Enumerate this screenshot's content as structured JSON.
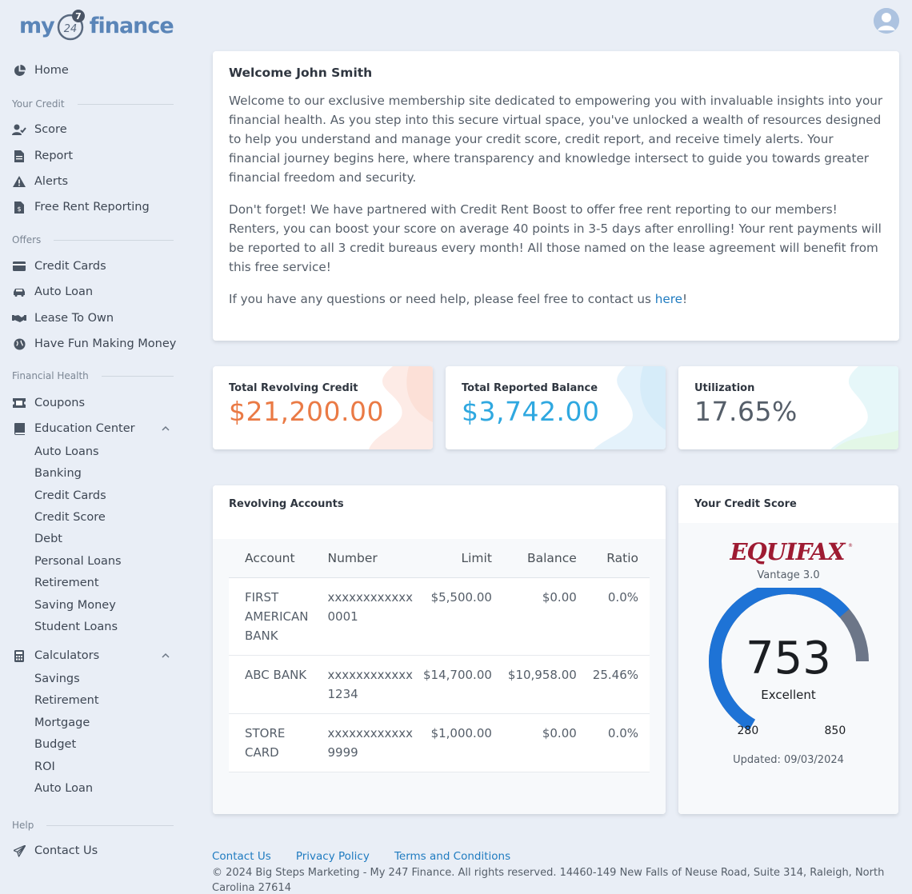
{
  "brand": {
    "logo_left": "my",
    "logo_clock": "247",
    "logo_right": "finance"
  },
  "colors": {
    "accent": "#1f7bc0",
    "orange": "#ea7a45",
    "blue": "#2fa8e0",
    "dark": "#555e69",
    "gauge_blue": "#1e73d6",
    "gauge_gray": "#6c7688"
  },
  "sidebar": {
    "home": {
      "label": "Home",
      "icon": "pie-chart-icon"
    },
    "sections": [
      {
        "title": "Your Credit"
      },
      {
        "title": "Offers"
      },
      {
        "title": "Financial Health"
      },
      {
        "title": "Help"
      }
    ],
    "credit_items": [
      {
        "label": "Score",
        "icon": "user-check-icon"
      },
      {
        "label": "Report",
        "icon": "document-icon"
      },
      {
        "label": "Alerts",
        "icon": "warning-icon"
      },
      {
        "label": "Free Rent Reporting",
        "icon": "invoice-icon"
      }
    ],
    "offer_items": [
      {
        "label": "Credit Cards",
        "icon": "credit-card-icon"
      },
      {
        "label": "Auto Loan",
        "icon": "car-icon"
      },
      {
        "label": "Lease To Own",
        "icon": "handshake-icon"
      },
      {
        "label": "Have Fun Making Money",
        "icon": "globe-icon"
      }
    ],
    "health_items": [
      {
        "label": "Coupons",
        "icon": "ticket-icon"
      },
      {
        "label": "Education Center",
        "icon": "book-icon"
      }
    ],
    "education_sub": [
      "Auto Loans",
      "Banking",
      "Credit Cards",
      "Credit Score",
      "Debt",
      "Personal Loans",
      "Retirement",
      "Saving Money",
      "Student Loans"
    ],
    "calculators": {
      "label": "Calculators",
      "icon": "calculator-icon"
    },
    "calculator_sub": [
      "Savings",
      "Retirement",
      "Mortgage",
      "Budget",
      "ROI",
      "Auto Loan"
    ],
    "contact": {
      "label": "Contact Us",
      "icon": "paper-plane-icon"
    }
  },
  "welcome": {
    "title": "Welcome John Smith",
    "para1": "Welcome to our exclusive membership site dedicated to empowering you with invaluable insights into your financial health. As you step into this secure virtual space, you've unlocked a wealth of resources designed to help you understand and manage your credit score, credit report, and receive timely alerts. Your financial journey begins here, where transparency and knowledge intersect to guide you towards greater financial freedom and security.",
    "para2": "Don't forget! We have partnered with Credit Rent Boost to offer free rent reporting to our members! Renters, you can boost your score on average 40 points in 3-5 days after enrolling! Your rent payments will be reported to all 3 credit bureaus every month! All those named on the lease agreement will benefit from this free service!",
    "para3_prefix": "If you have any questions or need help, please feel free to contact us ",
    "para3_link": "here",
    "para3_suffix": "!"
  },
  "stats": [
    {
      "title": "Total Revolving Credit",
      "value": "$21,200.00"
    },
    {
      "title": "Total Reported Balance",
      "value": "$3,742.00"
    },
    {
      "title": "Utilization",
      "value": "17.65%"
    }
  ],
  "accounts": {
    "title": "Revolving Accounts",
    "headers": [
      "Account",
      "Number",
      "Limit",
      "Balance",
      "Ratio"
    ],
    "rows": [
      {
        "account": "FIRST AMERICAN BANK",
        "number": "xxxxxxxxxxxx 0001",
        "limit": "$5,500.00",
        "balance": "$0.00",
        "ratio": "0.0%"
      },
      {
        "account": "ABC BANK",
        "number": "xxxxxxxxxxxx 1234",
        "limit": "$14,700.00",
        "balance": "$10,958.00",
        "ratio": "25.46%"
      },
      {
        "account": "STORE CARD",
        "number": "xxxxxxxxxxxx 9999",
        "limit": "$1,000.00",
        "balance": "$0.00",
        "ratio": "0.0%"
      }
    ]
  },
  "credit_score": {
    "title": "Your Credit Score",
    "bureau": "EQUIFAX",
    "model": "Vantage 3.0",
    "score": "753",
    "rating": "Excellent",
    "min": "280",
    "max": "850",
    "updated": "Updated: 09/03/2024"
  },
  "footer": {
    "links": [
      "Contact Us",
      "Privacy Policy",
      "Terms and Conditions"
    ],
    "copyright": "© 2024 Big Steps Marketing - My 247 Finance. All rights reserved. 14460-149 New Falls of Neuse Road, Suite 314, Raleigh, North Carolina 27614"
  }
}
